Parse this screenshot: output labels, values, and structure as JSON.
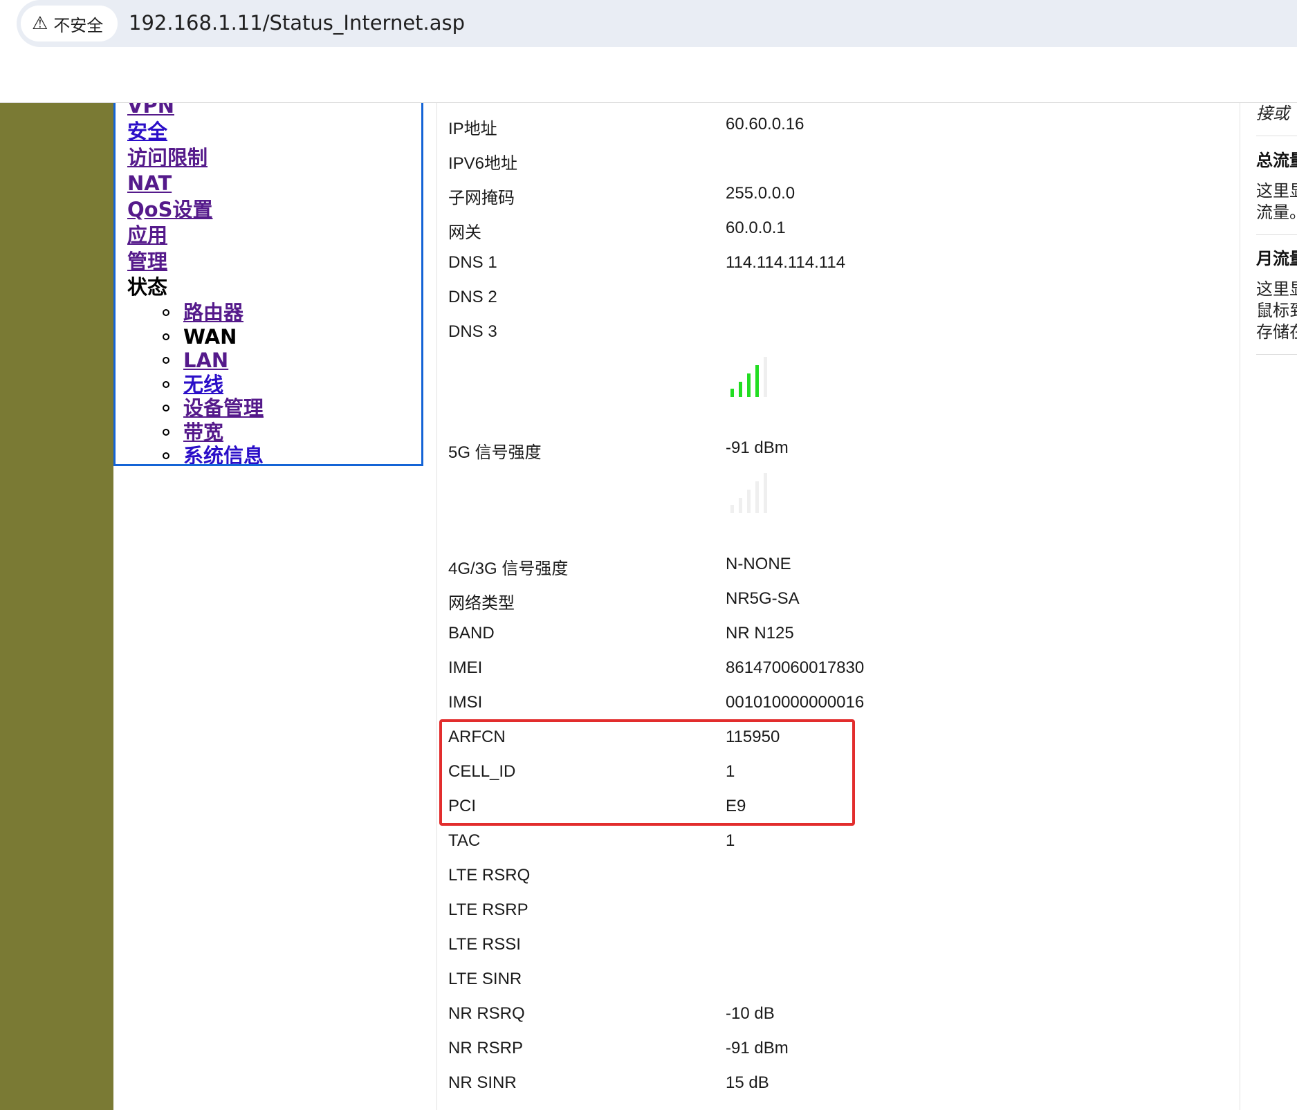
{
  "browser": {
    "security_label": "不安全",
    "url": "192.168.1.11/Status_Internet.asp"
  },
  "menu": {
    "items": [
      "VPN",
      "安全",
      "访问限制",
      "NAT",
      "QoS设置",
      "应用",
      "管理",
      "状态"
    ],
    "sub_items": [
      "路由器",
      "WAN",
      "LAN",
      "无线",
      "设备管理",
      "带宽",
      "系统信息"
    ]
  },
  "status": {
    "rows": [
      {
        "label": "IP地址",
        "value": "60.60.0.16"
      },
      {
        "label": "IPV6地址",
        "value": ""
      },
      {
        "label": "子网掩码",
        "value": "255.0.0.0"
      },
      {
        "label": "网关",
        "value": "60.0.0.1"
      },
      {
        "label": "DNS 1",
        "value": "114.114.114.114"
      },
      {
        "label": "DNS 2",
        "value": ""
      },
      {
        "label": "DNS 3",
        "value": ""
      },
      {
        "label": "5G 信号强度",
        "value": "-91 dBm"
      },
      {
        "label": "4G/3G 信号强度",
        "value": "N-NONE"
      },
      {
        "label": "网络类型",
        "value": "NR5G-SA"
      },
      {
        "label": "BAND",
        "value": "NR N125"
      },
      {
        "label": "IMEI",
        "value": "861470060017830"
      },
      {
        "label": "IMSI",
        "value": "001010000000016"
      },
      {
        "label": "ARFCN",
        "value": "115950"
      },
      {
        "label": "CELL_ID",
        "value": "1"
      },
      {
        "label": "PCI",
        "value": "E9"
      },
      {
        "label": "TAC",
        "value": "1"
      },
      {
        "label": "LTE RSRQ",
        "value": ""
      },
      {
        "label": "LTE RSRP",
        "value": ""
      },
      {
        "label": "LTE RSSI",
        "value": ""
      },
      {
        "label": "LTE SINR",
        "value": ""
      },
      {
        "label": "NR RSRQ",
        "value": "-10 dB"
      },
      {
        "label": "NR RSRP",
        "value": "-91 dBm"
      },
      {
        "label": "NR SINR",
        "value": "15 dB"
      }
    ],
    "signal_5g_bars": 4,
    "signal_4g_bars": 0,
    "signal_color": "#22dd22"
  },
  "help": {
    "line1": "接或",
    "total_title": "总流量",
    "total_text1": "这里显",
    "total_text2": "流量。",
    "month_title": "月流量",
    "month_text1": "这里显",
    "month_text2": "鼠标到",
    "month_text3": "存储在"
  },
  "colors": {
    "left_bar": "#7a7a34",
    "menu_border": "#1464d6",
    "highlight": "#e22d2d"
  }
}
